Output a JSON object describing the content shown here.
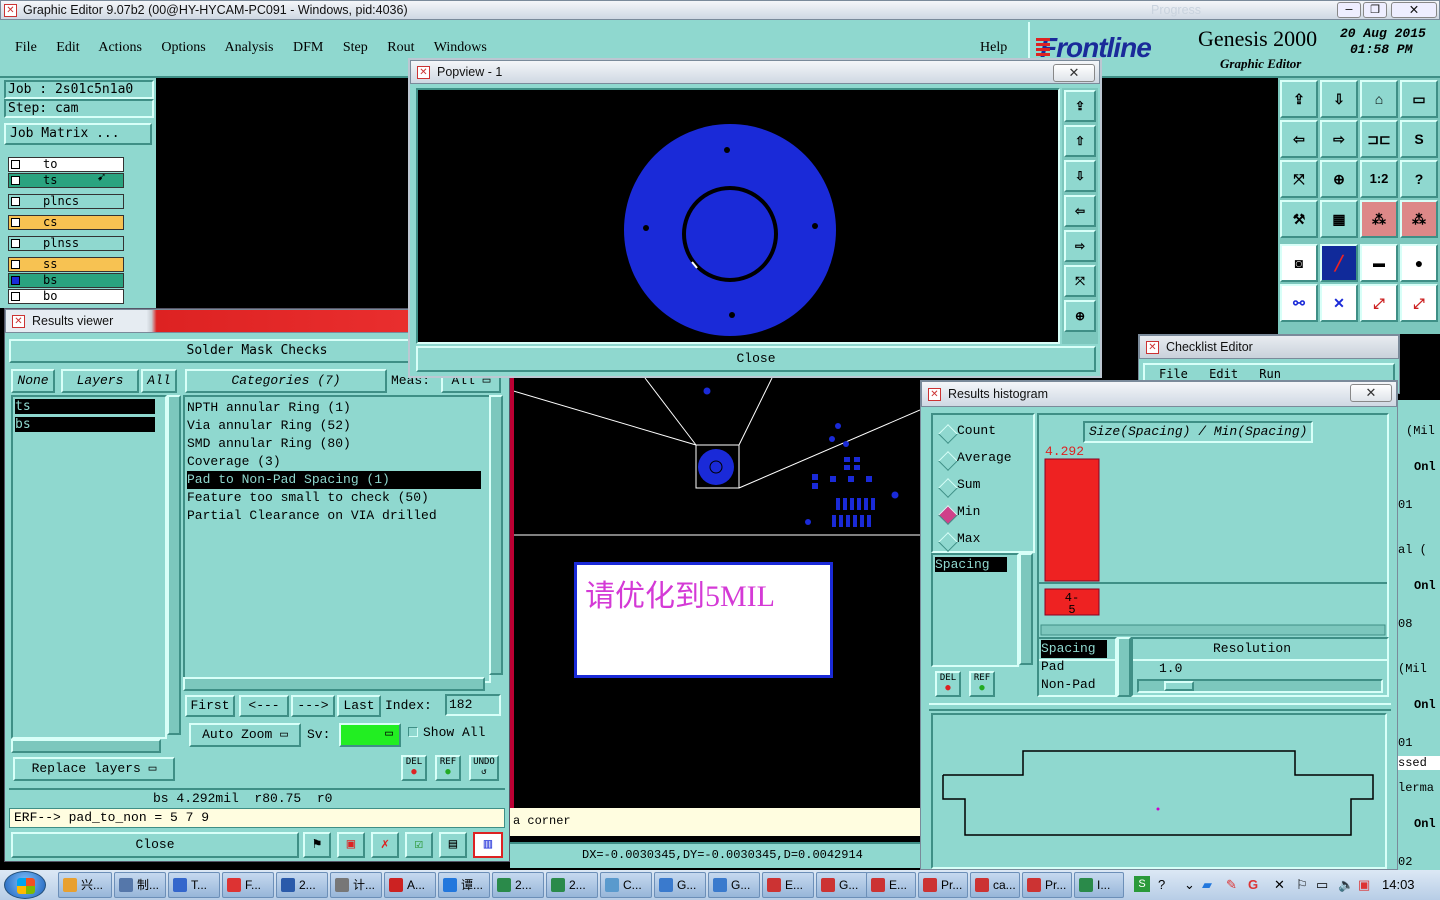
{
  "app": {
    "title": "Graphic Editor 9.07b2 (00@HY-HYCAM-PC091 - Windows, pid:4036)",
    "ghost_title": "Progress"
  },
  "menu": {
    "items": [
      "File",
      "Edit",
      "Actions",
      "Options",
      "Analysis",
      "DFM",
      "Step",
      "Rout",
      "Windows"
    ],
    "help": "Help"
  },
  "brand": {
    "logo": "Frontline",
    "product": "Genesis 2000",
    "subtitle": "Graphic Editor",
    "date": "20 Aug 2015",
    "time": "01:58 PM"
  },
  "job": {
    "job": "Job : 2s01c5n1a0",
    "step": "Step: cam",
    "matrix_button": "Job Matrix ..."
  },
  "layers": [
    {
      "name": "to",
      "color": "#ffffff"
    },
    {
      "name": "ts",
      "color": "#2aa37f"
    },
    {
      "name": "plncs",
      "color": "#8fd8cf"
    },
    {
      "name": "cs",
      "color": "#f7c252"
    },
    {
      "name": "plnss",
      "color": "#8fd8cf"
    },
    {
      "name": "ss",
      "color": "#f7c252"
    },
    {
      "name": "bs",
      "color": "#2aa37f"
    },
    {
      "name": "bo",
      "color": "#ffffff"
    }
  ],
  "results": {
    "title": "Results viewer",
    "heading": "Solder Mask Checks",
    "filter_none": "None",
    "filter_layers": "Layers",
    "filter_all": "All",
    "layer_items": [
      "ts",
      "bs"
    ],
    "categories_header": "Categories (7)",
    "meas_label": "Meas:",
    "meas_value": "All",
    "categories": [
      "NPTH annular Ring (1)",
      "Via annular Ring (52)",
      "SMD annular Ring (80)",
      "Coverage (3)",
      "Pad to Non-Pad Spacing (1)",
      "Feature too small to check (50)",
      "Partial Clearance on VIA drilled"
    ],
    "selected_category": 4,
    "nav_first": "First",
    "nav_prev": "<---",
    "nav_next": "--->",
    "nav_last": "Last",
    "index_label": "Index:",
    "index_value": "182",
    "auto_zoom": "Auto Zoom",
    "sv_label": "Sv:",
    "show_all": "Show All",
    "replace_layers": "Replace layers",
    "del_label": "DEL",
    "ref_label": "REF",
    "undo_label": "UNDO",
    "status": "bs 4.292mil  r80.75  r0",
    "erf_line": "ERF--> pad_to_non = 5 7 9",
    "close": "Close"
  },
  "popview": {
    "title": "Popview - 1",
    "close": "Close"
  },
  "canvas": {
    "annotation": "请优化到5MIL",
    "status_text": "a corner",
    "coords": "DX=-0.0030345,DY=-0.0030345,D=0.0042914"
  },
  "checklist": {
    "title": "Checklist Editor",
    "menu": [
      "File",
      "Edit",
      "Run"
    ]
  },
  "histogram": {
    "title": "Results histogram",
    "modes": [
      "Count",
      "Average",
      "Sum",
      "Min",
      "Max"
    ],
    "selected_mode": 3,
    "list_items": [
      "Spacing"
    ],
    "chart_title": "Size(Spacing) / Min(Spacing)",
    "bar_value": "4.292",
    "bin_label": "4-5",
    "measure_list": [
      "Spacing",
      "Pad",
      "Non-Pad"
    ],
    "resolution_label": "Resolution",
    "resolution_value": "1.0",
    "slider_fraction": 0.12,
    "del_label": "DEL",
    "ref_label": "REF"
  },
  "right_strip": [
    "(Mil",
    "Onl",
    "01",
    "al (",
    "Onl",
    "08",
    "(Mil",
    "Onl",
    "01",
    "ssed",
    "lerma",
    "Onl",
    "02"
  ],
  "taskbar": {
    "items": [
      "兴...",
      "制...",
      "T...",
      "F...",
      "2...",
      "计...",
      "A...",
      "谭...",
      "2...",
      "2...",
      "C...",
      "G...",
      "G...",
      "E...",
      "G...",
      "E...",
      "Pr...",
      "ca...",
      "Pr...",
      "I..."
    ],
    "clock": "14:03"
  }
}
